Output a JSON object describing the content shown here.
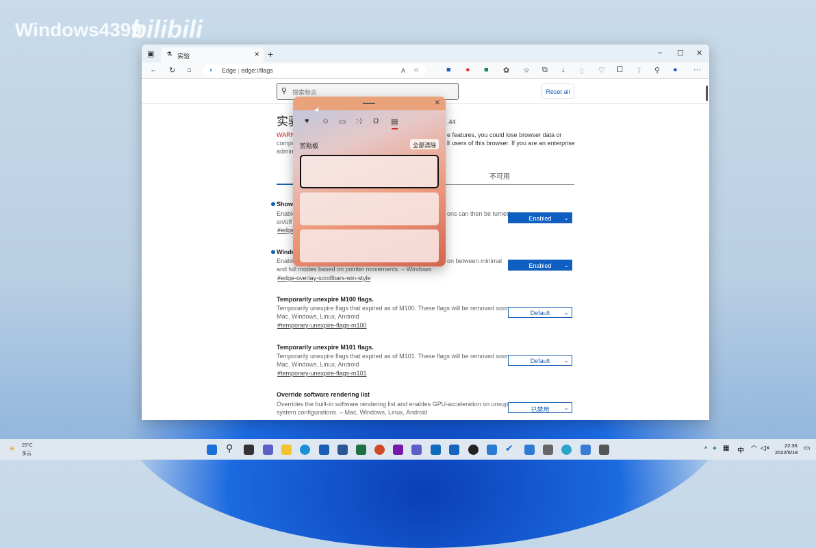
{
  "watermark": {
    "text": "Windows4399",
    "logo": "bilibili"
  },
  "browser": {
    "tab_title": "实验",
    "address_brand": "Edge",
    "url": "edge://flags"
  },
  "flags_page": {
    "search_placeholder": "搜索标志",
    "reset_all": "Reset all",
    "title": "实验",
    "version_fragment": ".44",
    "warning_left": [
      "WARN",
      "compr",
      "admin"
    ],
    "warning_right": [
      "e features, you could lose browser data or",
      "ll users of this browser. If you are an enterprise"
    ],
    "tab_unavailable": "不可用",
    "flags": [
      {
        "title": "Show e",
        "desc_left": [
          "Enable",
          "on/off"
        ],
        "desc_right": "ons can then be turned",
        "link": "#edge",
        "value": "Enabled"
      },
      {
        "title": "Windo",
        "desc_left": [
          "Enable",
          "and full modes based on pointer movements. – Windows"
        ],
        "desc_right": "on between minimal",
        "link": "#edge-overlay-scrollbars-win-style",
        "value": "Enabled"
      },
      {
        "title": "Temporarily unexpire M100 flags.",
        "desc": [
          "Temporarily unexpire flags that expired as of M100. These flags will be removed soon. –",
          "Mac, Windows, Linux, Android"
        ],
        "link": "#temporary-unexpire-flags-m100",
        "value": "Default"
      },
      {
        "title": "Temporarily unexpire M101 flags.",
        "desc": [
          "Temporarily unexpire flags that expired as of M101. These flags will be removed soon. –",
          "Mac, Windows, Linux, Android"
        ],
        "link": "#temporary-unexpire-flags-m101",
        "value": "Default"
      },
      {
        "title": "Override software rendering list",
        "desc": [
          "Overrides the built-in software rendering list and enables GPU-acceleration on unsupported",
          "system configurations. – Mac, Windows, Linux, Android"
        ],
        "value": "已禁用"
      }
    ]
  },
  "clipboard_panel": {
    "section": "剪贴板",
    "clear_all": "全部清除",
    "tabs": [
      "recent-icon",
      "emoji-icon",
      "gif-icon",
      "kaomoji-icon",
      "symbols-icon",
      "clipboard-icon"
    ]
  },
  "taskbar": {
    "temp": "25°C",
    "weather": "多云",
    "ime": "中",
    "time": "22:36",
    "date": "2022/6/18"
  }
}
